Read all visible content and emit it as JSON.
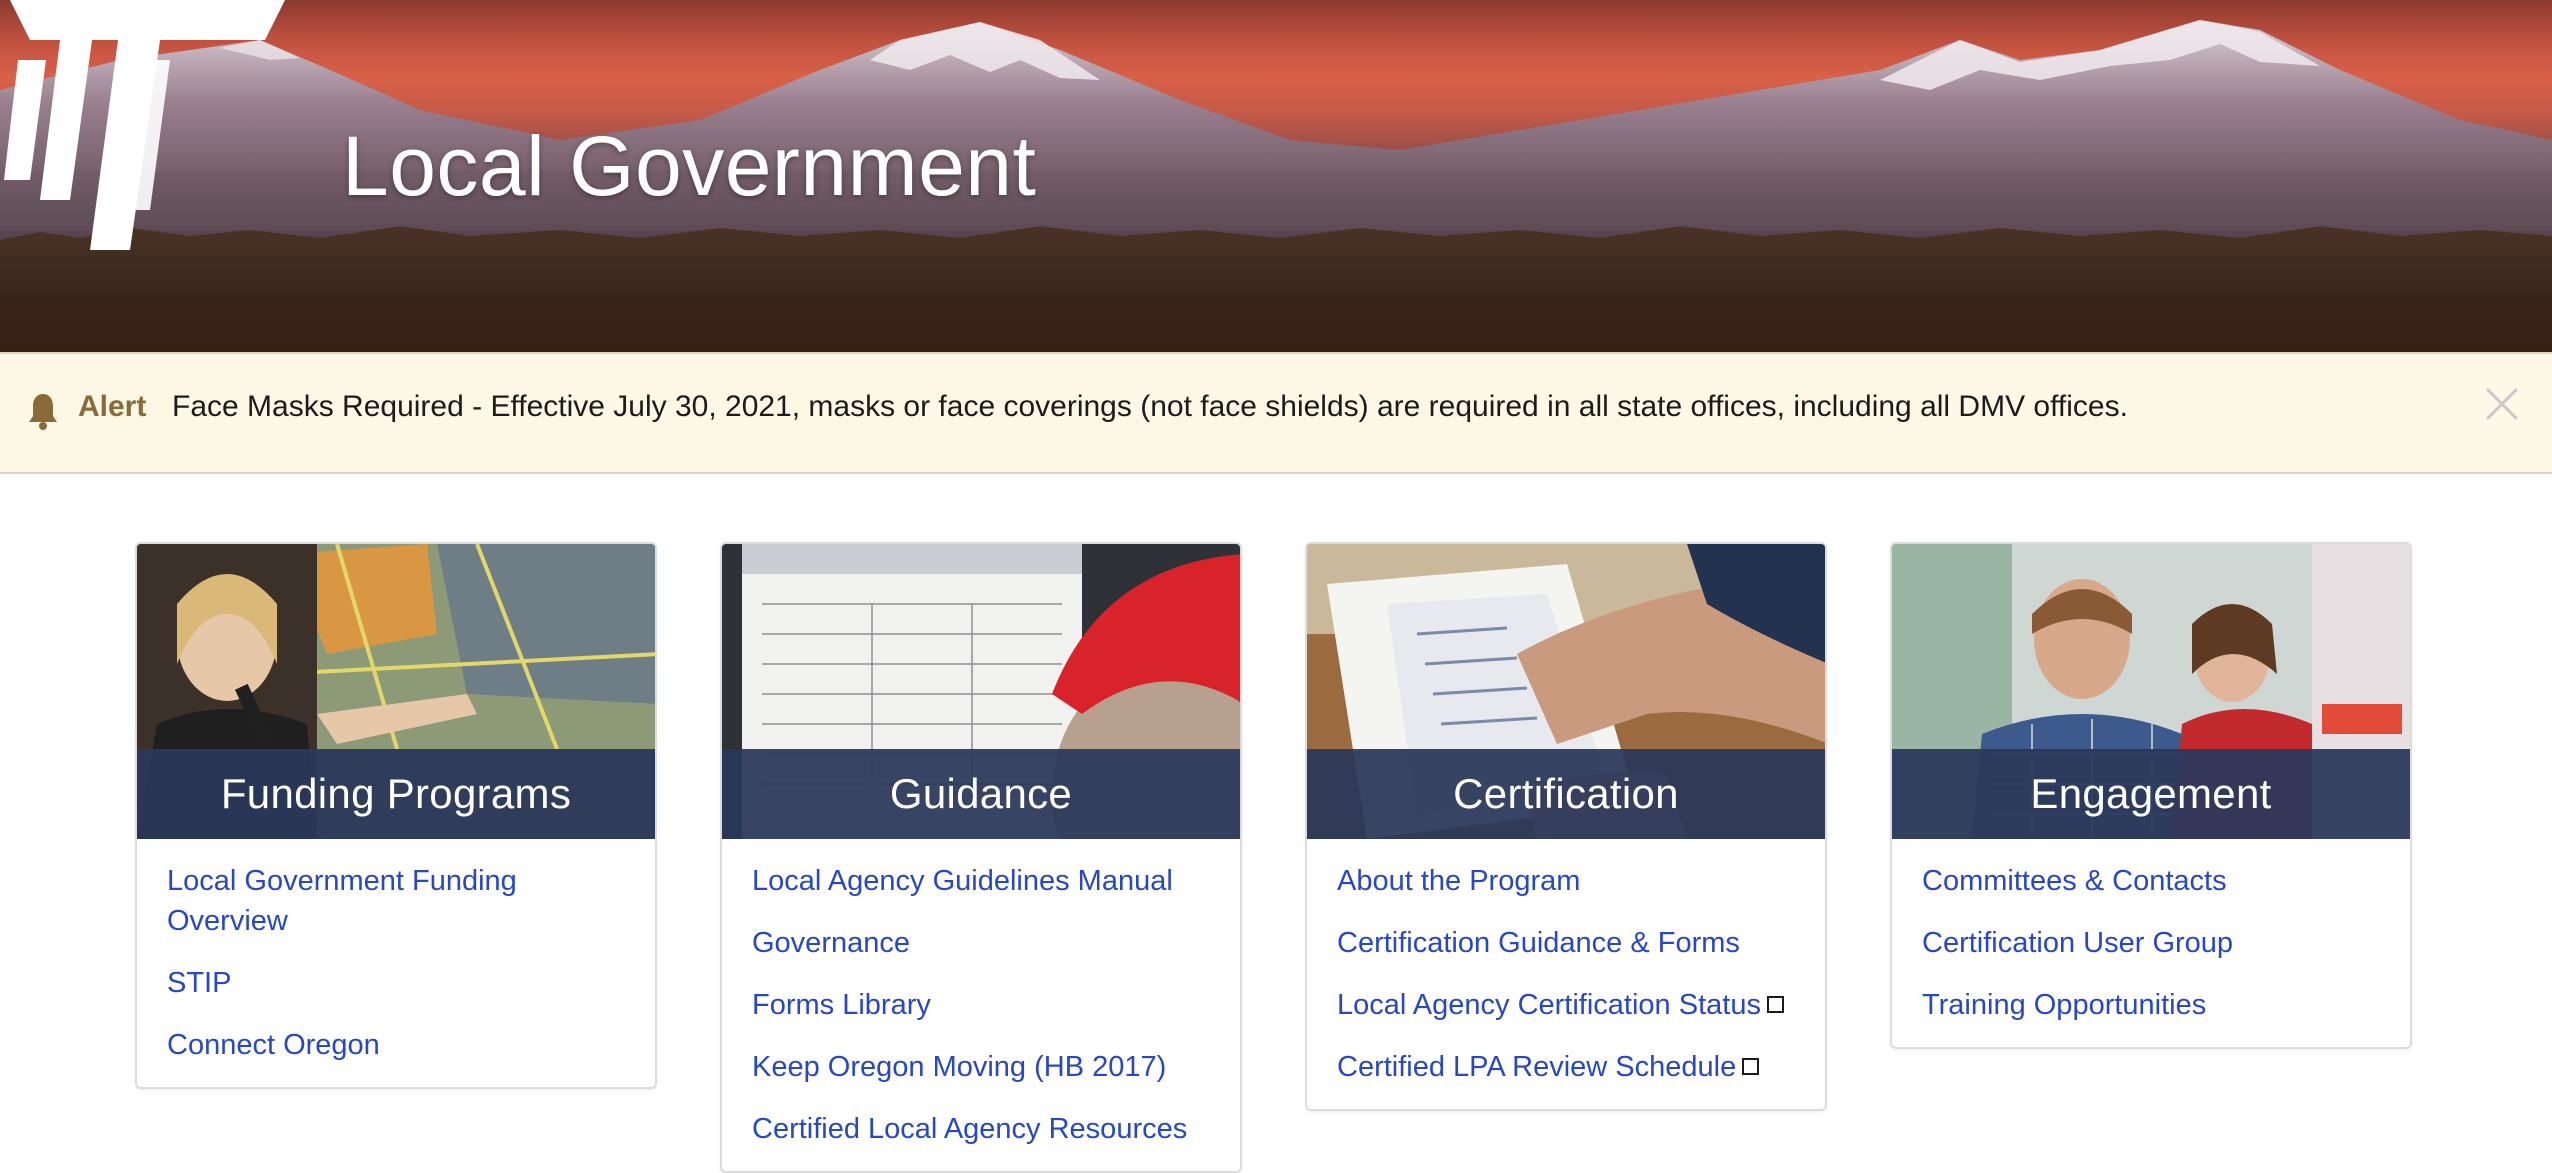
{
  "header": {
    "title": "Local Government",
    "logo_icon": "odot-logo-icon"
  },
  "alert": {
    "label": "Alert",
    "message": "Face Masks Required - Effective July 30, 2021, masks or face coverings (not face shields) are required in all state offices, including all DMV offices.",
    "icon": "bell-icon",
    "close_icon": "close-icon",
    "colors": {
      "background": "#fdf7e5",
      "label": "#8b6a3a"
    }
  },
  "colors": {
    "link": "#2747c7",
    "card_title_bar": "#2a385a"
  },
  "cards": [
    {
      "title": "Funding Programs",
      "links": [
        {
          "label": "Local Government Funding Overview",
          "external": false
        },
        {
          "label": "STIP",
          "external": false
        },
        {
          "label": "Connect Oregon",
          "external": false
        }
      ]
    },
    {
      "title": "Guidance",
      "links": [
        {
          "label": "Local Agency Guidelines Manual",
          "external": false
        },
        {
          "label": "Governance",
          "external": false
        },
        {
          "label": "Forms Library",
          "external": false
        },
        {
          "label": "Keep Oregon Moving (HB 2017)",
          "external": false
        },
        {
          "label": "Certified Local Agency Resources",
          "external": false
        }
      ]
    },
    {
      "title": "Certification",
      "links": [
        {
          "label": "About the Program",
          "external": false
        },
        {
          "label": "Certification Guidance & Forms",
          "external": false
        },
        {
          "label": "Local Agency Certification Status",
          "external": true
        },
        {
          "label": "Certified LPA Review Schedule",
          "external": true
        }
      ]
    },
    {
      "title": "Engagement",
      "links": [
        {
          "label": "Committees & Contacts",
          "external": false
        },
        {
          "label": "Certification User Group",
          "external": false
        },
        {
          "label": "Training Opportunities",
          "external": false
        }
      ]
    }
  ]
}
